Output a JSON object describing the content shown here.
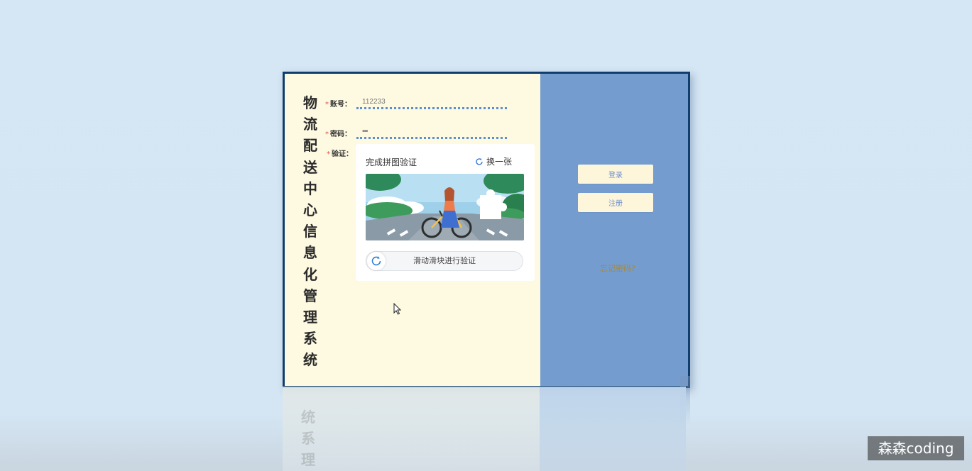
{
  "app": {
    "title_chars": "物流配送中心信息化管理系统"
  },
  "form": {
    "account_label": "账号：",
    "account_value": "112233",
    "password_label": "密码：",
    "password_value": "•••",
    "verify_label": "验证：",
    "required_mark": "*"
  },
  "captcha": {
    "title": "完成拼图验证",
    "refresh_label": "换一张",
    "slider_text": "滑动滑块进行验证"
  },
  "actions": {
    "login_label": "登录",
    "register_label": "注册",
    "forgot_label": "忘记密码?"
  },
  "watermark": {
    "text": "森森coding"
  },
  "colors": {
    "page_bg": "#d5e6f4",
    "card_bg": "#fef9e1",
    "card_border": "#0f3e6e",
    "right_panel": "#749ccf",
    "button_bg": "#fef6da",
    "input_underline": "#5b8fd0"
  },
  "icons": {
    "refresh": "refresh-icon",
    "cursor": "mouse-pointer-icon"
  }
}
